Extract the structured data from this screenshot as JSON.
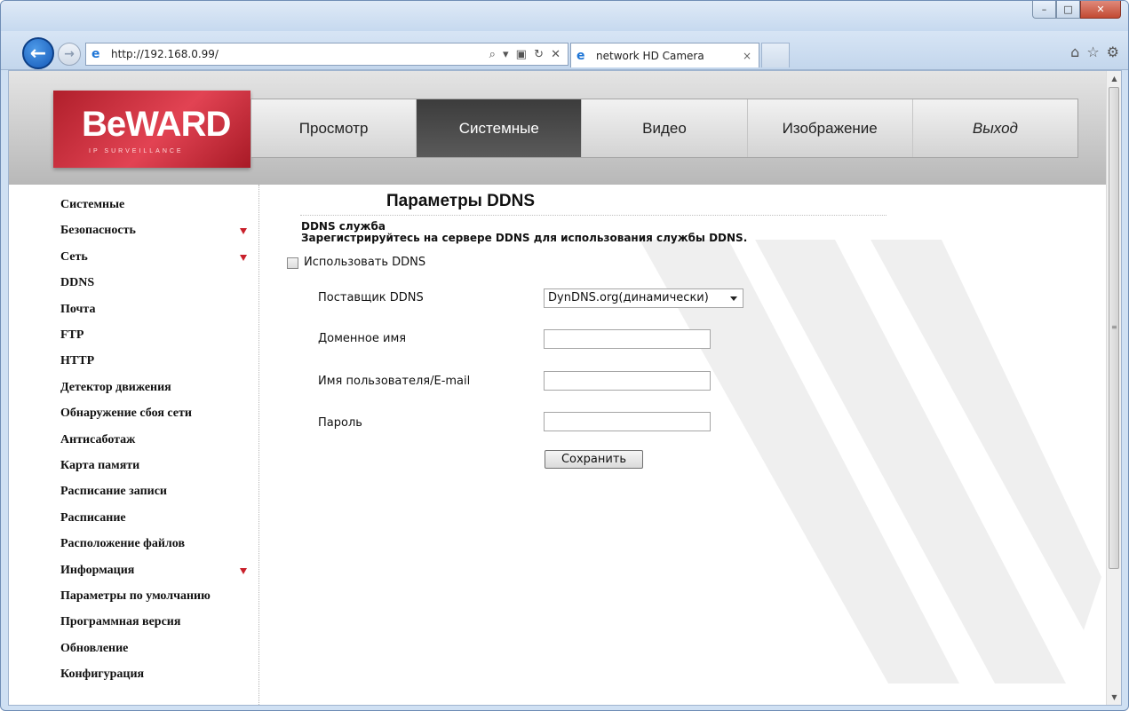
{
  "browser": {
    "url": "http://192.168.0.99/",
    "tab_title": "network HD Camera",
    "tab_close": "×",
    "address_tools": "⌕ ▾ ▣ ↻ ✕",
    "window_controls": {
      "minimize": "–",
      "maximize": "□",
      "close": "✕"
    },
    "toolbar_icons": {
      "home": "⌂",
      "favorites": "☆",
      "settings": "⚙"
    }
  },
  "header": {
    "logo_text": "BeWARD",
    "logo_sub": "IP SURVEILLANCE",
    "menu": [
      {
        "label": "Просмотр",
        "active": false
      },
      {
        "label": "Системные",
        "active": true
      },
      {
        "label": "Видео",
        "active": false
      },
      {
        "label": "Изображение",
        "active": false
      },
      {
        "label": "Выход",
        "active": false
      }
    ]
  },
  "sidebar": {
    "items": [
      {
        "label": "Системные",
        "arrow": false
      },
      {
        "label": "Безопасность",
        "arrow": true
      },
      {
        "label": "Сеть",
        "arrow": true
      },
      {
        "label": "DDNS",
        "arrow": false
      },
      {
        "label": "Почта",
        "arrow": false
      },
      {
        "label": "FTP",
        "arrow": false
      },
      {
        "label": "HTTP",
        "arrow": false
      },
      {
        "label": "Детектор движения",
        "arrow": false
      },
      {
        "label": "Обнаружение сбоя сети",
        "arrow": false
      },
      {
        "label": "Антисаботаж",
        "arrow": false
      },
      {
        "label": "Карта памяти",
        "arrow": false
      },
      {
        "label": "Расписание записи",
        "arrow": false
      },
      {
        "label": "Расписание",
        "arrow": false
      },
      {
        "label": "Расположение файлов",
        "arrow": false
      },
      {
        "label": "Информация",
        "arrow": true
      },
      {
        "label": "Параметры по умолчанию",
        "arrow": false
      },
      {
        "label": "Программная версия",
        "arrow": false
      },
      {
        "label": "Обновление",
        "arrow": false
      },
      {
        "label": "Конфигурация",
        "arrow": false
      }
    ]
  },
  "content": {
    "title": "Параметры DDNS",
    "section_title": "DDNS служба",
    "section_desc": "Зарегистрируйтесь на сервере DDNS для использования службы DDNS.",
    "use_ddns_label": "Использовать DDNS",
    "use_ddns_checked": false,
    "provider_label": "Поставщик DDNS",
    "provider_value": "DynDNS.org(динамически)",
    "domain_label": "Доменное имя",
    "domain_value": "",
    "user_label": "Имя пользователя/E-mail",
    "user_value": "",
    "password_label": "Пароль",
    "password_value": "",
    "save_label": "Сохранить"
  },
  "colors": {
    "accent_red": "#c9202b",
    "active_menu": "#4a4a4a",
    "logo_red": "#d63342"
  }
}
